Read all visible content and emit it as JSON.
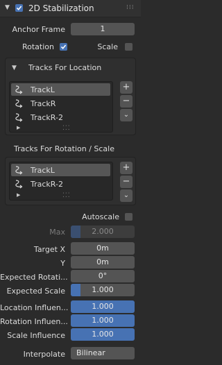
{
  "panel": {
    "title": "2D Stabilization",
    "enabled": true
  },
  "anchor_frame": {
    "label": "Anchor Frame",
    "value": "1"
  },
  "rotation": {
    "label": "Rotation",
    "checked": true
  },
  "scale": {
    "label": "Scale",
    "checked": false
  },
  "location_tracks": {
    "header": "Tracks For Location",
    "items": [
      "TrackL",
      "TrackR",
      "TrackR-2"
    ],
    "selected": "TrackL",
    "add": "+",
    "remove": "−",
    "more": "⌄"
  },
  "rotation_tracks": {
    "header": "Tracks For Rotation / Scale",
    "items": [
      "TrackL",
      "TrackR-2"
    ],
    "selected": "TrackL",
    "add": "+",
    "remove": "−",
    "more": "⌄"
  },
  "autoscale": {
    "label": "Autoscale",
    "checked": false
  },
  "max": {
    "label": "Max",
    "value": "2.000"
  },
  "target_x": {
    "label": "Target X",
    "value": "0m"
  },
  "target_y": {
    "label": "Y",
    "value": "0m"
  },
  "expected_rotation": {
    "label": "Expected Rotati...",
    "value": "0°"
  },
  "expected_scale": {
    "label": "Expected Scale",
    "value": "1.000"
  },
  "location_influence": {
    "label": "Location Influen...",
    "value": "1.000",
    "fill": 1.0
  },
  "rotation_influence": {
    "label": "Rotation Influen...",
    "value": "1.000",
    "fill": 1.0
  },
  "scale_influence": {
    "label": "Scale Influence",
    "value": "1.000",
    "fill": 1.0
  },
  "interpolate": {
    "label": "Interpolate",
    "value": "Bilinear"
  },
  "colors": {
    "accent": "#4772b3",
    "panel_bg": "#2b2b2b",
    "field_bg": "#545454"
  }
}
